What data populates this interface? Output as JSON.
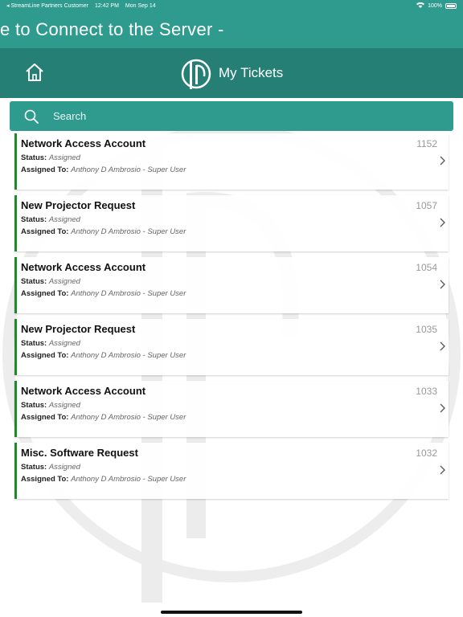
{
  "status_bar": {
    "back_app": "◂ StreamLine Partners Customer",
    "time": "12:42 PM",
    "date": "Mon Sep 14",
    "battery": "100%"
  },
  "banner": {
    "text": "e to Connect to the Server -"
  },
  "nav": {
    "title": "My Tickets",
    "home_icon": "home-icon",
    "logo_icon": "app-logo-icon"
  },
  "search": {
    "placeholder": "Search",
    "value": ""
  },
  "labels": {
    "status": "Status:",
    "assigned_to": "Assigned To:"
  },
  "colors": {
    "primary": "#2f9b8f",
    "nav_dark": "#267f75",
    "ticket_accent": "#1e8a2a"
  },
  "tickets": [
    {
      "title": "Network Access Account",
      "id": "1152",
      "status": "Assigned",
      "assigned_to": "Anthony D Ambrosio - Super User"
    },
    {
      "title": "New Projector Request",
      "id": "1057",
      "status": "Assigned",
      "assigned_to": "Anthony D Ambrosio - Super User"
    },
    {
      "title": "Network Access Account",
      "id": "1054",
      "status": "Assigned",
      "assigned_to": "Anthony D Ambrosio - Super User"
    },
    {
      "title": "New Projector Request",
      "id": "1035",
      "status": "Assigned",
      "assigned_to": "Anthony D Ambrosio - Super User"
    },
    {
      "title": "Network Access Account",
      "id": "1033",
      "status": "Assigned",
      "assigned_to": "Anthony D Ambrosio - Super User"
    },
    {
      "title": "Misc. Software Request",
      "id": "1032",
      "status": "Assigned",
      "assigned_to": "Anthony D Ambrosio - Super User"
    }
  ]
}
